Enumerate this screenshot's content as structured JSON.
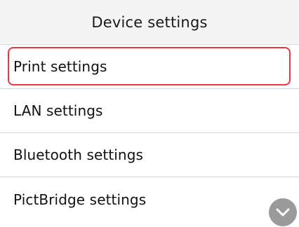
{
  "header": {
    "title": "Device settings"
  },
  "menu": {
    "selected_index": 0,
    "items": [
      {
        "label": "Print settings"
      },
      {
        "label": "LAN settings"
      },
      {
        "label": "Bluetooth settings"
      },
      {
        "label": "PictBridge settings"
      }
    ]
  },
  "icons": {
    "scroll_down": "chevron-down-icon"
  },
  "colors": {
    "selection_border": "#e8383d",
    "header_background": "#f4f4f4",
    "scroll_button": "#9a9a9a"
  }
}
